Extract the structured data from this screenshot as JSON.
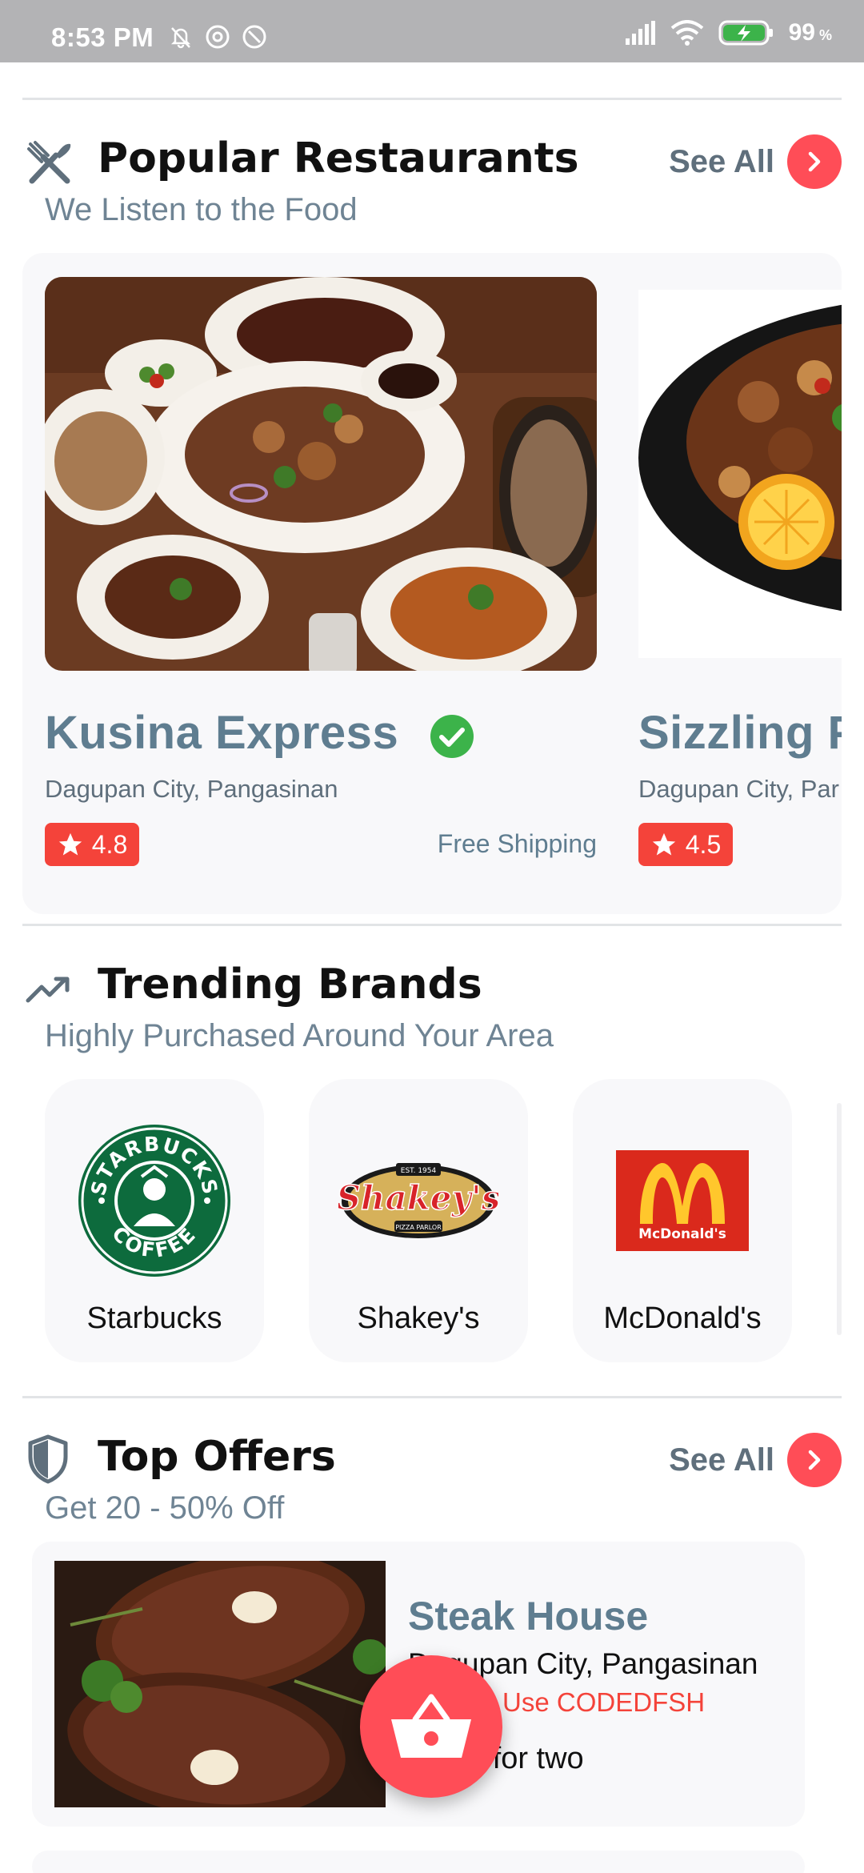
{
  "status_bar": {
    "time": "8:53 PM",
    "battery": "99"
  },
  "popular": {
    "title": "Popular Restaurants",
    "subtitle": "We Listen to the Food",
    "see_all": "See All",
    "restaurants": [
      {
        "name": "Kusina Express",
        "location": "Dagupan City, Pangasinan",
        "rating": "4.8",
        "shipping": "Free Shipping",
        "verified": true
      },
      {
        "name": "Sizzling P",
        "location": "Dagupan City, Par",
        "rating": "4.5"
      }
    ]
  },
  "trending": {
    "title": "Trending Brands",
    "subtitle": "Highly Purchased Around Your Area",
    "brands": [
      {
        "name": "Starbucks",
        "logo_text_top": "STARBUCKS",
        "logo_text_bottom": "COFFEE"
      },
      {
        "name": "Shakey's",
        "logo_text": "Shakey's",
        "logo_est": "EST. 1954",
        "logo_sub": "PIZZA PARLOR"
      },
      {
        "name": "McDonald's",
        "logo_text": "McDonald's"
      }
    ]
  },
  "offers": {
    "title": "Top Offers",
    "subtitle": "Get 20 - 50% Off",
    "see_all": "See All",
    "items": [
      {
        "name": "Steak House",
        "location": "Dagupan City, Pangasinan",
        "deal": ".00 off | Use CODEDFSH",
        "price": "50.00 for two"
      }
    ]
  },
  "colors": {
    "accent": "#ff4d57",
    "rating": "#f4433a",
    "heading_blue": "#5f7d90",
    "verified": "#3cb34a"
  },
  "icons": [
    "fork-knife-icon",
    "trending-up-icon",
    "shield-icon",
    "chevron-right-icon",
    "star-icon",
    "check-icon",
    "basket-icon"
  ]
}
